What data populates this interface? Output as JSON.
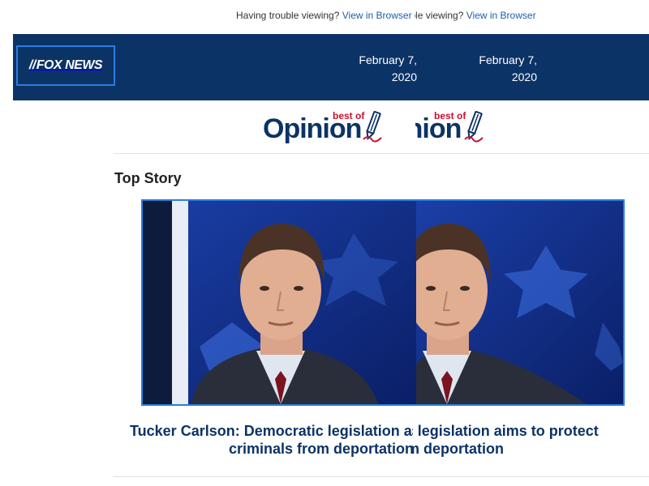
{
  "topbar": {
    "trouble_text": "Having trouble viewing?",
    "view_link": "View in Browser"
  },
  "header": {
    "logo_text": "FOX NEWS",
    "date_line1": "February 7,",
    "date_line2": "2020"
  },
  "branding": {
    "opinion_word": "Opinion",
    "best_of": "best of",
    "pencil_icon": "pencil-icon"
  },
  "section": {
    "heading": "Top Story"
  },
  "story": {
    "image_alt": "Tucker Carlson",
    "headline_line1": "Tucker Carlson: Democratic legislation aims to protect",
    "headline_line2": "criminals from deportation"
  },
  "colors": {
    "header_bg": "#0c3366",
    "accent_blue": "#2a7de1",
    "link": "#1a5eb0",
    "red": "#c8102e"
  }
}
